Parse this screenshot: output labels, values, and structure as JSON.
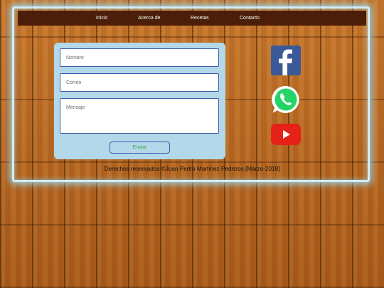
{
  "nav": {
    "items": [
      "Inicio",
      "Acerca de",
      "Recetas",
      "Contacto"
    ]
  },
  "form": {
    "name_placeholder": "Nombre",
    "email_placeholder": "Correo",
    "message_placeholder": "Mensaje",
    "submit_label": "Enviar"
  },
  "social": [
    {
      "name": "facebook-icon",
      "color": "#3b5998"
    },
    {
      "name": "whatsapp-icon",
      "color": "#25d366"
    },
    {
      "name": "youtube-icon",
      "color": "#e62117"
    }
  ],
  "footer": {
    "text": "Derechos reservados ©Juan Pedro Martínez Pedrizco [Marzo-2018]"
  }
}
